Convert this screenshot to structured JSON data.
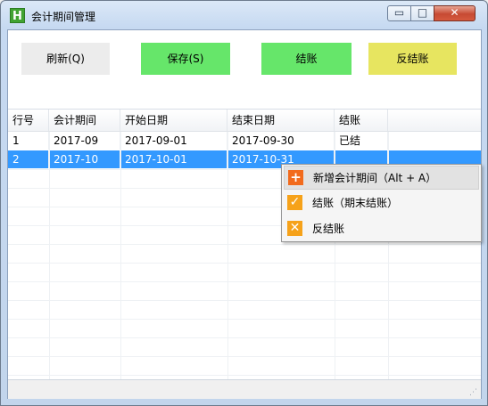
{
  "window": {
    "title": "会计期间管理",
    "app_icon_letter": "H"
  },
  "titlebar_buttons": {
    "minimize": "▭",
    "maximize": "□",
    "close": "✕"
  },
  "toolbar": {
    "refresh_label": "刷新(Q)",
    "save_label": "保存(S)",
    "close_label": "结账",
    "unclose_label": "反结账"
  },
  "grid": {
    "columns": [
      "行号",
      "会计期间",
      "开始日期",
      "结束日期",
      "结账"
    ],
    "rows": [
      [
        "1",
        "2017-09",
        "2017-09-01",
        "2017-09-30",
        "已结"
      ],
      [
        "2",
        "2017-10",
        "2017-10-01",
        "2017-10-31",
        ""
      ]
    ],
    "selected_row": 2
  },
  "context_menu": {
    "items": [
      {
        "label": "新增会计期间（Alt + A）",
        "icon": "plus-icon"
      },
      {
        "label": "结账（期末结账）",
        "icon": "check-icon"
      },
      {
        "label": "反结账",
        "icon": "cross-icon"
      }
    ]
  },
  "colors": {
    "green_button": "#66e66a",
    "yellow_button": "#e7e560",
    "selection": "#3399ff",
    "menu_add_icon": "#f26b1d",
    "menu_icon": "#f6a21a"
  }
}
